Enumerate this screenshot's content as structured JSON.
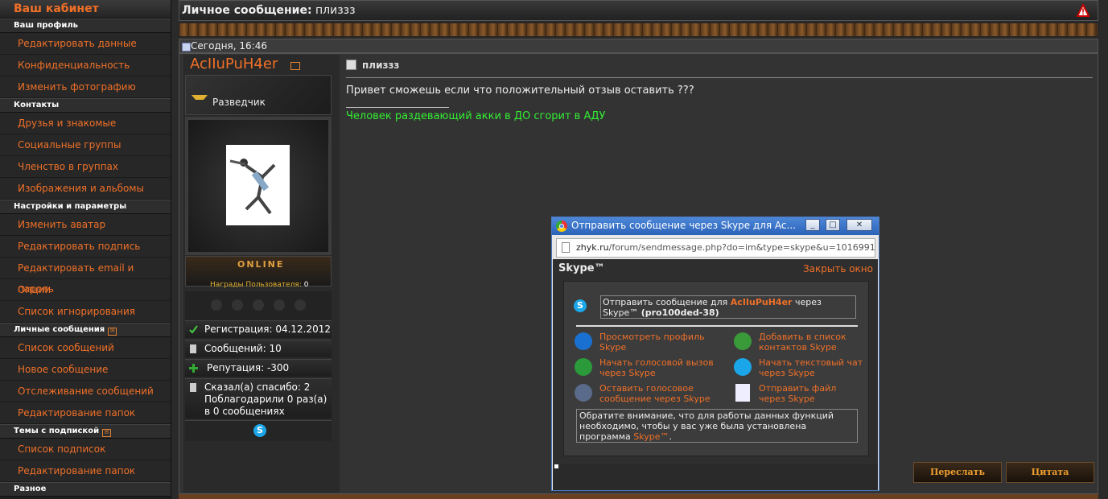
{
  "sidebar": {
    "title": "Ваш кабинет",
    "sections": {
      "profile": "Ваш профиль",
      "contacts": "Контакты",
      "settings": "Настройки и параметры",
      "pm": "Личные сообщения",
      "subs": "Темы с подпиской",
      "misc": "Разное"
    },
    "items": {
      "edit_data": "Редактировать данные",
      "privacy": "Конфиденциальность",
      "change_photo": "Изменить фотографию",
      "friends": "Друзья и знакомые",
      "social_groups": "Социальные группы",
      "group_membership": "Членство в группах",
      "images_albums": "Изображения и альбомы",
      "change_avatar": "Изменить аватар",
      "edit_signature": "Редактировать подпись",
      "edit_email": "Редактировать email и пароль",
      "options": "Опции",
      "ignore_list": "Список игнорирования",
      "message_list": "Список сообщений",
      "new_message": "Новое сообщение",
      "track_messages": "Отслеживание сообщений",
      "edit_folders_pm": "Редактирование папок",
      "subscription_list": "Список подписок",
      "edit_folders_subs": "Редактирование папок"
    }
  },
  "header": {
    "label": "Личное сообщение:",
    "subject": "плиззз"
  },
  "post": {
    "date": "Сегодня, 16:46",
    "title": "плиззз",
    "text": "Привет сможешь если что положительный отзыв оставить ???",
    "signature": "Человек раздевающий акки в ДО сгорит в АДУ"
  },
  "user": {
    "name": "AcIIuPuH4er",
    "rank": "Разведчик",
    "status": "ONLINE",
    "awards_label": "Награды Пользователя:",
    "awards_count": "0",
    "registration": "Регистрация: 04.12.2012",
    "messages": "Сообщений: 10",
    "reputation": "Репутация: -300",
    "thanks": "Сказал(а) спасибо: 2 Поблагодарили 0 раз(а) в 0 сообщениях"
  },
  "buttons": {
    "forward": "Переслать",
    "quote": "Цитата"
  },
  "popup": {
    "title": "Отправить сообщение через Skype для Ac...",
    "url_domain": "zhyk.ru",
    "url_path": "/forum/sendmessage.php?do=im&type=skype&u=1016991",
    "skype_heading": "Skype™",
    "close_window": "Закрыть окно",
    "send_prefix": "Отправить сообщение для",
    "send_user": "AcIIuPuH4er",
    "send_via": "через Skype™",
    "skype_id": "(pro100ded-38)",
    "link_profile": "Просмотреть профиль Skype",
    "link_add_contact": "Добавить в список контактов Skype",
    "link_voice_call": "Начать голосовой вызов через Skype",
    "link_text_chat": "Начать текстовый чат через Skype",
    "link_voicemail": "Оставить голосовое сообщение через Skype",
    "link_send_file": "Отправить файл через Skype",
    "note_text": "Обратите внимание, что для работы данных функций необходимо, чтобы у вас уже была установлена программа",
    "note_link": "Skype™",
    "note_end": "."
  },
  "colors": {
    "accent": "#f07028",
    "signature": "#33ee33",
    "skype_blue": "#1aa6e8",
    "window_title": "#2a62b8"
  }
}
